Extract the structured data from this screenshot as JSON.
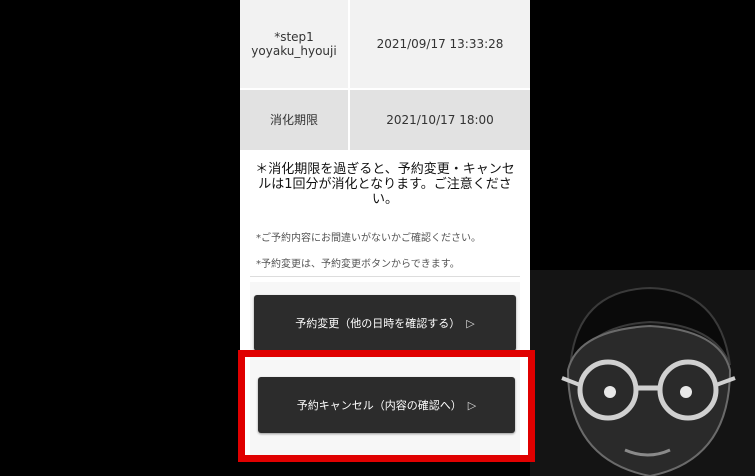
{
  "table": {
    "row1": {
      "label": "*step1\nyoyaku_hyouji",
      "value": "2021/09/17 13:33:28"
    },
    "row2": {
      "label": "消化期限",
      "value": "2021/10/17 18:00"
    }
  },
  "notice": {
    "main": "＊消化期限を過ぎると、予約変更・キャンセルは1回分が消化となります。ご注意ください。",
    "line1": "*ご予約内容にお間違いがないかご確認ください。",
    "line2": "*予約変更は、予約変更ボタンからできます。"
  },
  "buttons": {
    "change_label": "予約変更（他の日時を確認する）",
    "cancel_label": "予約キャンセル（内容の確認へ）",
    "arrow": "▷"
  },
  "colors": {
    "highlight": "#e00000",
    "button_bg": "#2c2c2c",
    "row_bg": "#f2f2f2"
  },
  "icons": {
    "arrow": "play-outline-icon",
    "character": "glasses-person-illustration"
  }
}
